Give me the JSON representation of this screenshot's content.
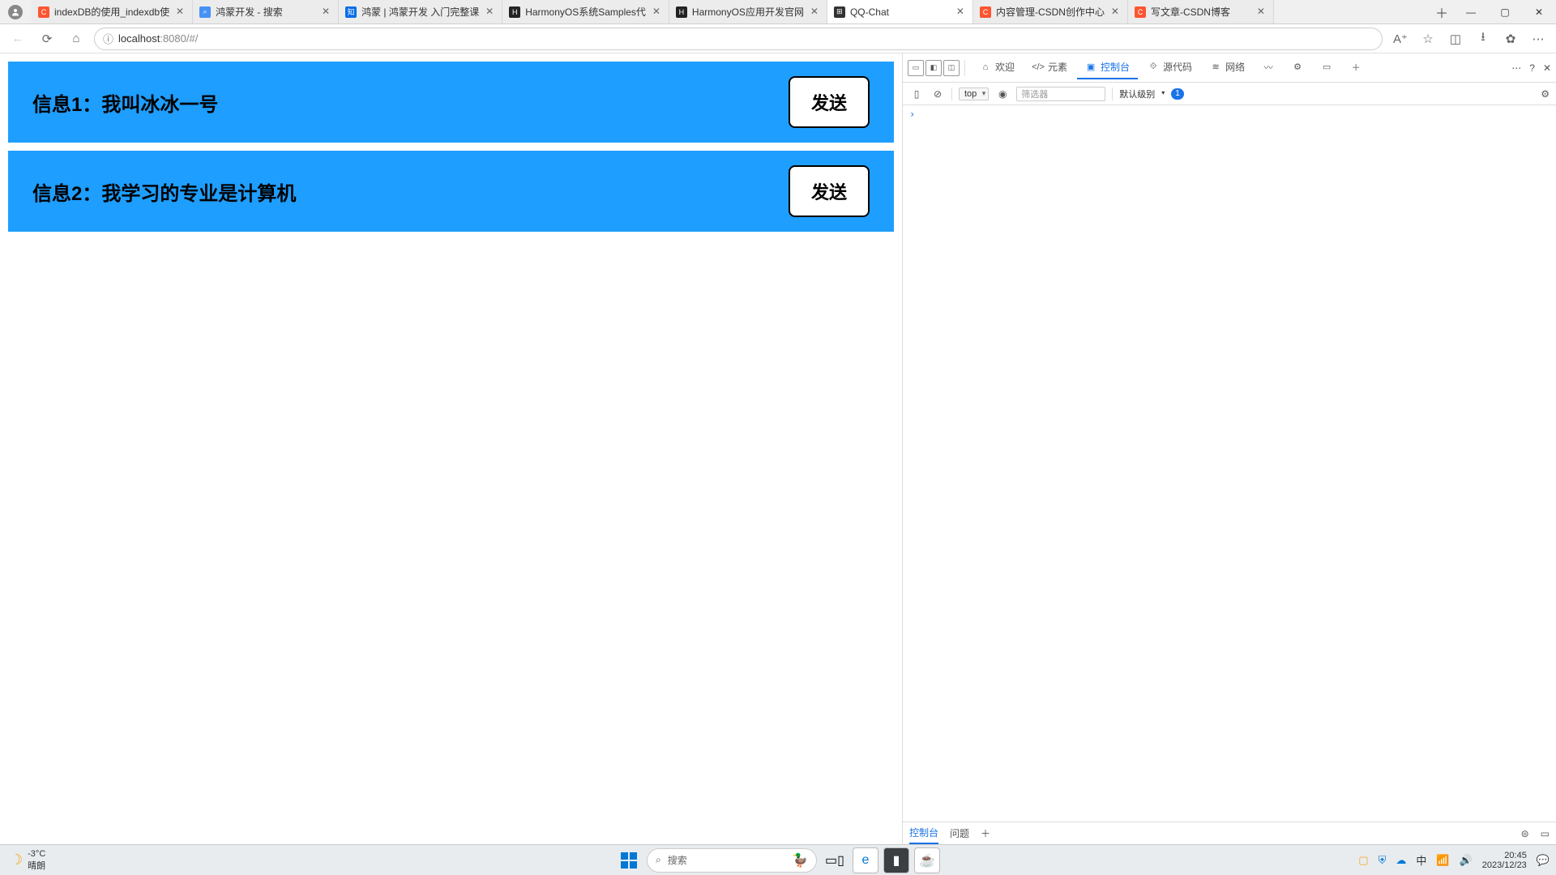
{
  "tabs": [
    {
      "title": "indexDB的使用_indexdb使",
      "favicon_bg": "#fc5530",
      "favicon_txt": "C"
    },
    {
      "title": "鸿蒙开发 - 搜索",
      "favicon_bg": "#4691f5",
      "favicon_txt": "⌕"
    },
    {
      "title": "鸿蒙 | 鸿蒙开发 入门完整课",
      "favicon_bg": "#056de8",
      "favicon_txt": "知"
    },
    {
      "title": "HarmonyOS系统Samples代",
      "favicon_bg": "#222",
      "favicon_txt": "H"
    },
    {
      "title": "HarmonyOS应用开发官网",
      "favicon_bg": "#222",
      "favicon_txt": "H"
    },
    {
      "title": "QQ-Chat",
      "favicon_bg": "#333",
      "favicon_txt": "⊞",
      "active": true
    },
    {
      "title": "内容管理-CSDN创作中心",
      "favicon_bg": "#fc5530",
      "favicon_txt": "C"
    },
    {
      "title": "写文章-CSDN博客",
      "favicon_bg": "#fc5530",
      "favicon_txt": "C"
    }
  ],
  "url": {
    "host": "localhost",
    "port_path": ":8080/#/"
  },
  "page": {
    "cards": [
      {
        "text": "信息1：我叫冰冰一号",
        "btn": "发送"
      },
      {
        "text": "信息2：我学习的专业是计算机",
        "btn": "发送"
      }
    ]
  },
  "devtools": {
    "tabs": {
      "welcome": "欢迎",
      "elements": "元素",
      "console": "控制台",
      "sources": "源代码",
      "network": "网络"
    },
    "top": "top",
    "filter_placeholder": "筛选器",
    "level": "默认级别",
    "badge": "1",
    "bottom": {
      "console": "控制台",
      "issues": "问题"
    }
  },
  "taskbar": {
    "temp": "-3°C",
    "weather": "晴朗",
    "search": "搜索",
    "ime": "中",
    "time": "20:45",
    "date": "2023/12/23"
  }
}
